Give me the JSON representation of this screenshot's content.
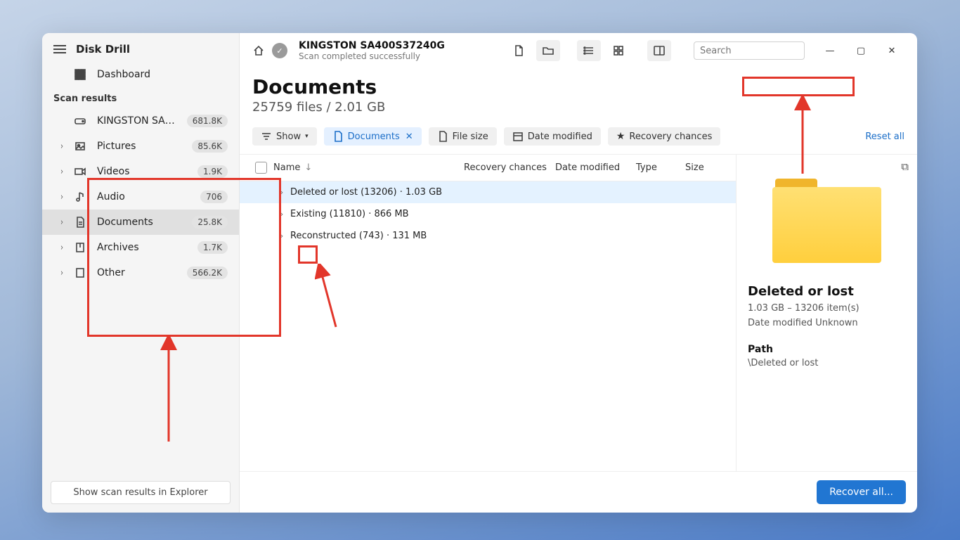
{
  "app_title": "Disk Drill",
  "sidebar": {
    "dashboard": "Dashboard",
    "section": "Scan results",
    "drive": {
      "label": "KINGSTON SA400S37...",
      "badge": "681.8K"
    },
    "cats": [
      {
        "label": "Pictures",
        "badge": "85.6K",
        "icon": "image"
      },
      {
        "label": "Videos",
        "badge": "1.9K",
        "icon": "video"
      },
      {
        "label": "Audio",
        "badge": "706",
        "icon": "audio"
      },
      {
        "label": "Documents",
        "badge": "25.8K",
        "icon": "doc",
        "active": true
      },
      {
        "label": "Archives",
        "badge": "1.7K",
        "icon": "archive"
      },
      {
        "label": "Other",
        "badge": "566.2K",
        "icon": "other"
      }
    ],
    "bottom": "Show scan results in Explorer"
  },
  "topbar": {
    "title": "KINGSTON SA400S37240G",
    "subtitle": "Scan completed successfully",
    "search_placeholder": "Search"
  },
  "heading": {
    "title": "Documents",
    "sub": "25759 files / 2.01 GB"
  },
  "filters": {
    "show": "Show",
    "documents": "Documents",
    "filesize": "File size",
    "datemod": "Date modified",
    "recovery": "Recovery chances",
    "reset": "Reset all"
  },
  "columns": {
    "name": "Name",
    "rec": "Recovery chances",
    "date": "Date modified",
    "type": "Type",
    "size": "Size"
  },
  "rows": [
    {
      "label": "Deleted or lost (13206) · 1.03 GB",
      "selected": true
    },
    {
      "label": "Existing (11810) · 866 MB"
    },
    {
      "label": "Reconstructed (743) · 131 MB"
    }
  ],
  "preview": {
    "title": "Deleted or lost",
    "line1": "1.03 GB – 13206 item(s)",
    "line2": "Date modified Unknown",
    "path_label": "Path",
    "path": "\\Deleted or lost"
  },
  "footer": {
    "recover": "Recover all..."
  }
}
